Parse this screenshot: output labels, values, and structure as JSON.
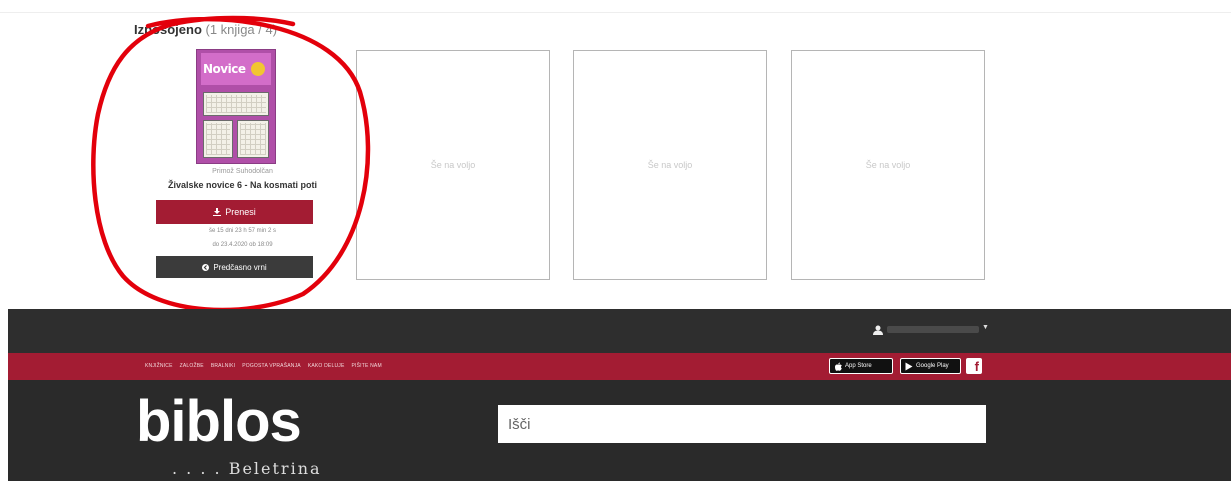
{
  "loans": {
    "heading": "Izposojeno",
    "count": "(1 knjiga / 4)"
  },
  "book": {
    "cover_title": "Novice",
    "author": "Primož Suhodolčan",
    "title": "Živalske novice 6 - Na kosmati poti",
    "download_label": "Prenesi",
    "due_remaining": "še 15 dni 23 h 57 min 2 s",
    "due_date": "do 23.4.2020 ob 18:09",
    "return_label": "Predčasno vrni"
  },
  "slots": [
    {
      "label": "Še na voljo"
    },
    {
      "label": "Še na voljo"
    },
    {
      "label": "Še na voljo"
    }
  ],
  "footer": {
    "nav": [
      "KNJIŽNICE",
      "ZALOŽBE",
      "BRALNIKI",
      "POGOSTA VPRAŠANJA",
      "KAKO DELUJE",
      "PIŠITE NAM"
    ],
    "app_store_label": "App Store",
    "google_play_label": "Google Play",
    "logo": "biblos",
    "tagline": ". . . . Beletrina",
    "search_placeholder": "Išči"
  },
  "colors": {
    "accent": "#a31c33",
    "dark": "#2e2e2e",
    "annotation": "#e3000b"
  },
  "icons": [
    "download-icon",
    "return-icon",
    "user-icon",
    "apple-icon",
    "google-play-icon",
    "facebook-icon"
  ]
}
